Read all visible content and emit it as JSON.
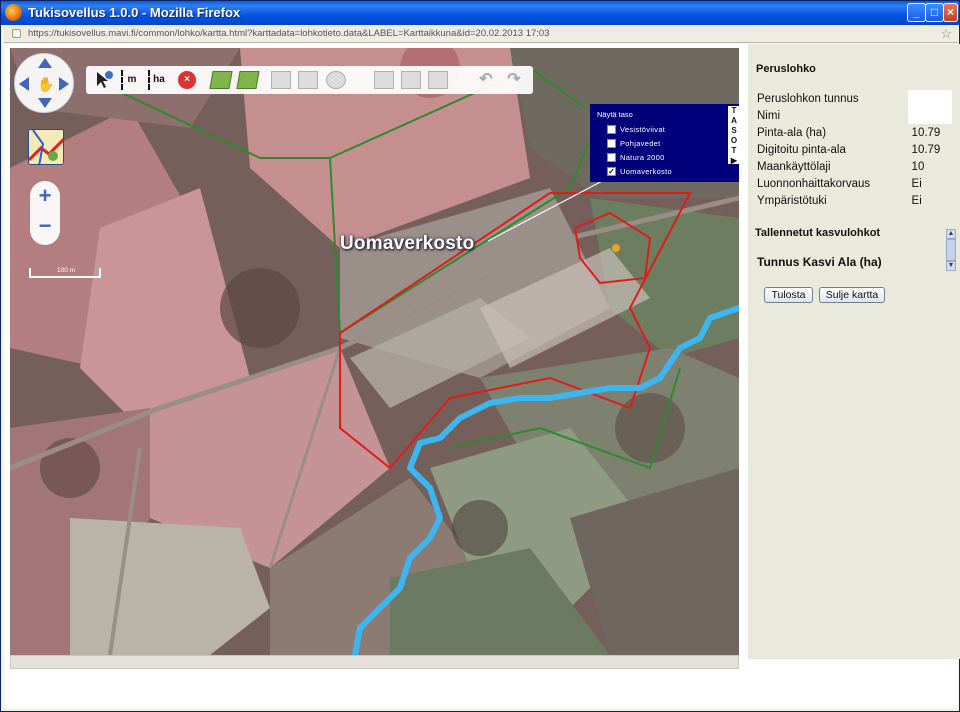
{
  "window": {
    "title": "Tukisovellus 1.0.0 - Mozilla Firefox",
    "url": "https://tukisovellus.mavi.fi/common/lohko/kartta.html?karttadata=lohkotieto.data&LABEL=Karttaikkuna&id=20.02.2013 17:03"
  },
  "map": {
    "scale_label": "100 m",
    "callout_label": "Uomaverkosto",
    "layer_panel": {
      "header": "Näytä taso",
      "tab_letters": [
        "T",
        "A",
        "S",
        "O",
        "T"
      ],
      "tab_arrow": "▶",
      "layers": [
        {
          "label": "Vesistöviivat",
          "checked": false
        },
        {
          "label": "Pohjavedet",
          "checked": false
        },
        {
          "label": "Natura 2000",
          "checked": false
        },
        {
          "label": "Uomaverkosto",
          "checked": true
        }
      ]
    },
    "toolbar": {
      "measure_length_label": "m",
      "measure_area_label": "ha"
    },
    "zoom": {
      "in": "+",
      "out": "−"
    }
  },
  "panel": {
    "title": "Peruslohko",
    "properties": [
      {
        "label": "Peruslohkon tunnus",
        "value": ""
      },
      {
        "label": "Nimi",
        "value": ""
      },
      {
        "label": "Pinta-ala (ha)",
        "value": "10.79"
      },
      {
        "label": "Digitoitu pinta-ala",
        "value": "10.79"
      },
      {
        "label": "Maankäyttölaji",
        "value": "10"
      },
      {
        "label": "Luonnonhaittakorvaus",
        "value": "Ei"
      },
      {
        "label": "Ympäristötuki",
        "value": "Ei"
      }
    ],
    "saved_title": "Tallennetut kasvulohkot",
    "saved_header": "Tunnus Kasvi Ala (ha)",
    "buttons": {
      "print": "Tulosta",
      "close": "Sulje kartta"
    }
  },
  "colors": {
    "title_bar": "#0554e3",
    "layer_panel": "#00007a",
    "field_outline": "#e01b1b",
    "block_outline": "#2e8a2e",
    "stream": "#3bb6f0",
    "panel_bg": "#e9eadc"
  }
}
